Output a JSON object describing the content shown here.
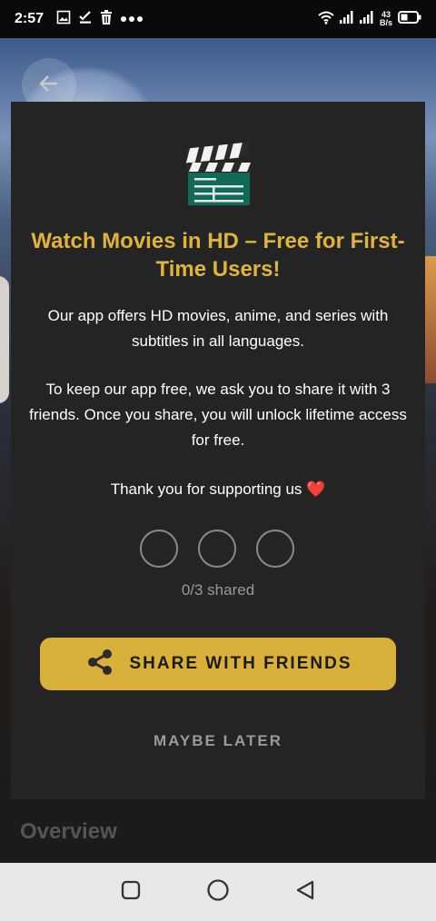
{
  "status_bar": {
    "time": "2:57",
    "net_speed_value": "43",
    "net_speed_unit": "B/s",
    "icons": [
      "gallery-icon",
      "checklist-icon",
      "trash-icon",
      "more-dots-icon",
      "wifi-icon",
      "signal-icon",
      "signal-icon",
      "battery-icon"
    ]
  },
  "background": {
    "section_title": "Overview"
  },
  "modal": {
    "title": "Watch Movies in HD – Free for First-Time Users!",
    "paragraph1": "Our app offers HD movies, anime, and series with subtitles in all languages.",
    "paragraph2": "To keep our app free, we ask you to share it with 3 friends. Once you share, you will unlock lifetime access for free.",
    "thanks": "Thank you for supporting us ❤️",
    "progress": {
      "shared": 0,
      "total": 3,
      "label": "0/3 shared"
    },
    "share_button": "SHARE WITH FRIENDS",
    "later_button": "MAYBE LATER"
  },
  "colors": {
    "accent": "#d9b03a",
    "title": "#e0b43a",
    "modal_bg": "#242424"
  }
}
